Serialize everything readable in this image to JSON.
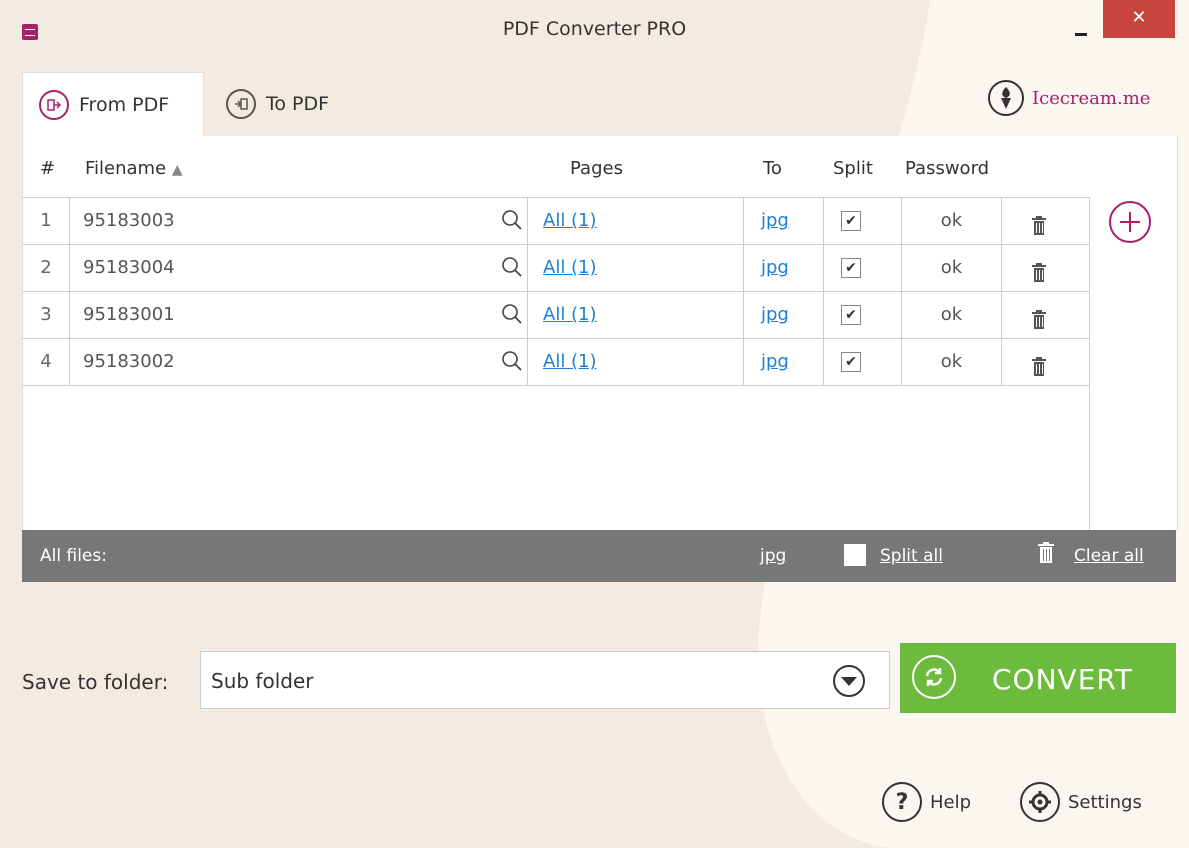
{
  "window": {
    "title": "PDF Converter PRO",
    "close_glyph": "✕"
  },
  "tabs": [
    {
      "label": "From PDF",
      "icon": "from-pdf-icon",
      "active": true
    },
    {
      "label": "To PDF",
      "icon": "to-pdf-icon",
      "active": false
    }
  ],
  "brand": {
    "label": "Icecream.me",
    "icon": "icecream-icon"
  },
  "table": {
    "headers": {
      "num": "#",
      "filename": "Filename",
      "pages": "Pages",
      "to": "To",
      "split": "Split",
      "password": "Password"
    },
    "rows": [
      {
        "num": "1",
        "filename": "95183003",
        "pages": "All (1)",
        "to": "jpg",
        "split": true,
        "password": "ok"
      },
      {
        "num": "2",
        "filename": "95183004",
        "pages": "All (1)",
        "to": "jpg",
        "split": true,
        "password": "ok"
      },
      {
        "num": "3",
        "filename": "95183001",
        "pages": "All (1)",
        "to": "jpg",
        "split": true,
        "password": "ok"
      },
      {
        "num": "4",
        "filename": "95183002",
        "pages": "All (1)",
        "to": "jpg",
        "split": true,
        "password": "ok"
      }
    ]
  },
  "footer_bar": {
    "all_files": "All files:",
    "format": "jpg",
    "split_all": "Split all",
    "clear_all": "Clear all"
  },
  "save": {
    "label": "Save to folder:",
    "value": "Sub folder"
  },
  "convert": {
    "label": "CONVERT"
  },
  "bottom": {
    "help": "Help",
    "settings": "Settings"
  },
  "colors": {
    "accent": "#a5226b",
    "convert_green": "#6cbb3c",
    "link_blue": "#1e7fd6",
    "footer_gray": "#777777",
    "bg": "#f3ebe2"
  }
}
